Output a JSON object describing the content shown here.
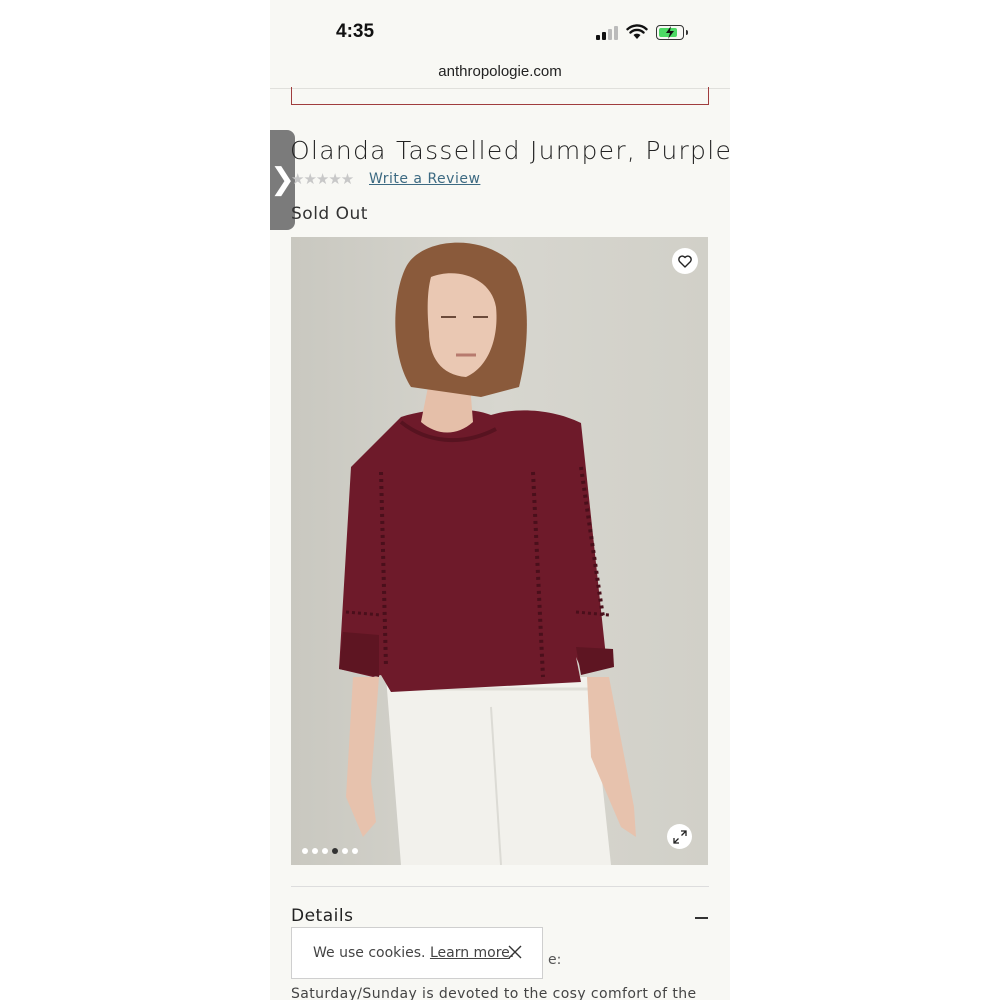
{
  "status_bar": {
    "time": "4:35"
  },
  "browser": {
    "url": "anthropologie.com"
  },
  "product": {
    "title": "Olanda Tasselled Jumper, Purple",
    "stars": "★★★★★",
    "review_link": "Write a Review",
    "availability": "Sold Out",
    "image_count": 6,
    "active_image_index": 3
  },
  "details": {
    "heading": "Details",
    "partial_text": "e:",
    "description_visible": "Saturday/Sunday is devoted to the cosy comfort of the"
  },
  "cookie_banner": {
    "text": "We use cookies.",
    "link": "Learn more",
    "suffix": "."
  },
  "colors": {
    "sweater": "#6e1a2a",
    "link": "#3d6a82",
    "page_bg": "#f8f8f4"
  },
  "icons": {
    "side_tab": "chevron-right-icon",
    "favorite": "heart-icon",
    "expand": "expand-icon",
    "close": "close-icon",
    "collapse": "minus-icon"
  }
}
